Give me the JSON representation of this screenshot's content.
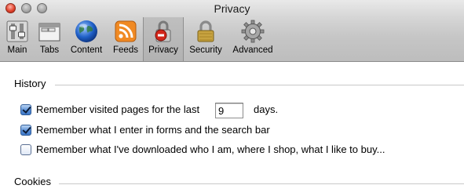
{
  "window": {
    "title": "Privacy"
  },
  "toolbar": {
    "items": [
      {
        "label": "Main",
        "icon": "main-switches-icon"
      },
      {
        "label": "Tabs",
        "icon": "tabs-window-icon"
      },
      {
        "label": "Content",
        "icon": "globe-icon"
      },
      {
        "label": "Feeds",
        "icon": "rss-feed-icon"
      },
      {
        "label": "Privacy",
        "icon": "privacy-lock-icon",
        "selected": true
      },
      {
        "label": "Security",
        "icon": "padlock-icon"
      },
      {
        "label": "Advanced",
        "icon": "gear-icon"
      }
    ]
  },
  "history": {
    "title": "History",
    "visited": {
      "checked": true,
      "label": "Remember visited pages for the last",
      "days_value": "9",
      "suffix": "days."
    },
    "forms": {
      "checked": true,
      "label": "Remember what I enter in forms and the search bar"
    },
    "downloads": {
      "checked": false,
      "label": "Remember what I've downloaded who I am, where I shop, what I like to buy..."
    }
  },
  "cookies": {
    "title": "Cookies"
  },
  "colors": {
    "selected_tab": "#b8b8b8",
    "close_button": "#e2452f",
    "checkbox_on": "#4a82cf"
  }
}
